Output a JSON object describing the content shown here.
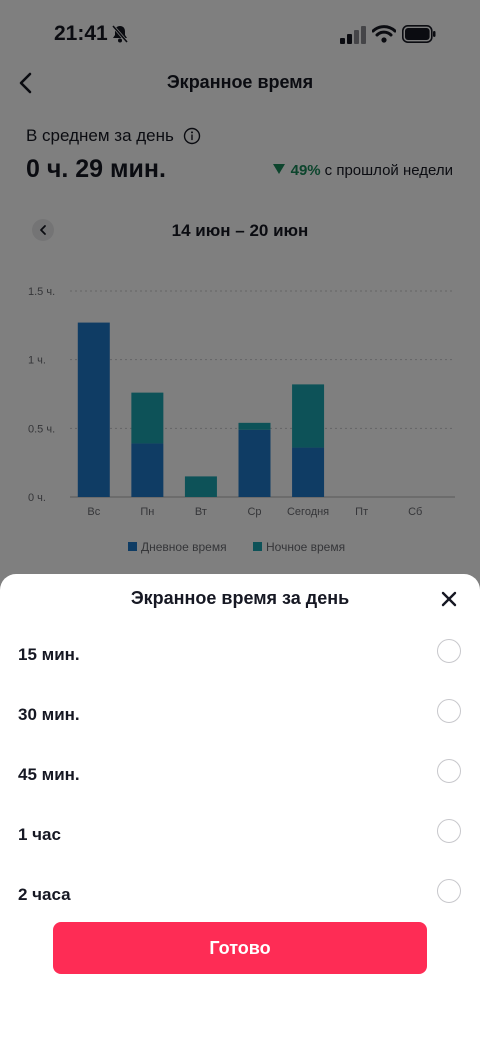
{
  "status_bar": {
    "time": "21:41"
  },
  "header": {
    "title": "Экранное время"
  },
  "summary": {
    "avg_label": "В среднем за день",
    "avg_value": "0 ч. 29 мин.",
    "change_percent": "49%",
    "change_text": "с прошлой недели",
    "change_direction": "down"
  },
  "week": {
    "range": "14 июн – 20 июн"
  },
  "chart_data": {
    "type": "bar",
    "stacked": true,
    "categories": [
      "Вс",
      "Пн",
      "Вт",
      "Ср",
      "Сегодня",
      "Пт",
      "Сб"
    ],
    "series": [
      {
        "name": "Дневное время",
        "values": [
          1.27,
          0.39,
          0,
          0.49,
          0.36,
          0,
          0
        ],
        "color": "#1f78c8"
      },
      {
        "name": "Ночное время",
        "values": [
          0,
          0.37,
          0.15,
          0.05,
          0.46,
          0,
          0
        ],
        "color": "#1aa4b0"
      }
    ],
    "y_ticks": [
      "0 ч.",
      "0.5 ч.",
      "1 ч.",
      "1.5 ч."
    ],
    "ylim": [
      0,
      1.5
    ],
    "grid": true,
    "legend": "bottom"
  },
  "sheet": {
    "title": "Экранное время за день",
    "options": [
      {
        "label": "15 мин.",
        "selected": false
      },
      {
        "label": "30 мин.",
        "selected": false
      },
      {
        "label": "45 мин.",
        "selected": false
      },
      {
        "label": "1 час",
        "selected": false
      },
      {
        "label": "2 часа",
        "selected": false
      }
    ],
    "done_label": "Готово"
  },
  "colors": {
    "accent": "#fe2c55",
    "positive": "#1a8a5a",
    "day_series": "#1f78c8",
    "night_series": "#1aa4b0"
  },
  "icons": [
    "bell-slash-icon",
    "signal-icon",
    "wifi-icon",
    "battery-icon",
    "back-arrow-icon",
    "info-icon",
    "chevron-left-icon",
    "close-icon"
  ]
}
